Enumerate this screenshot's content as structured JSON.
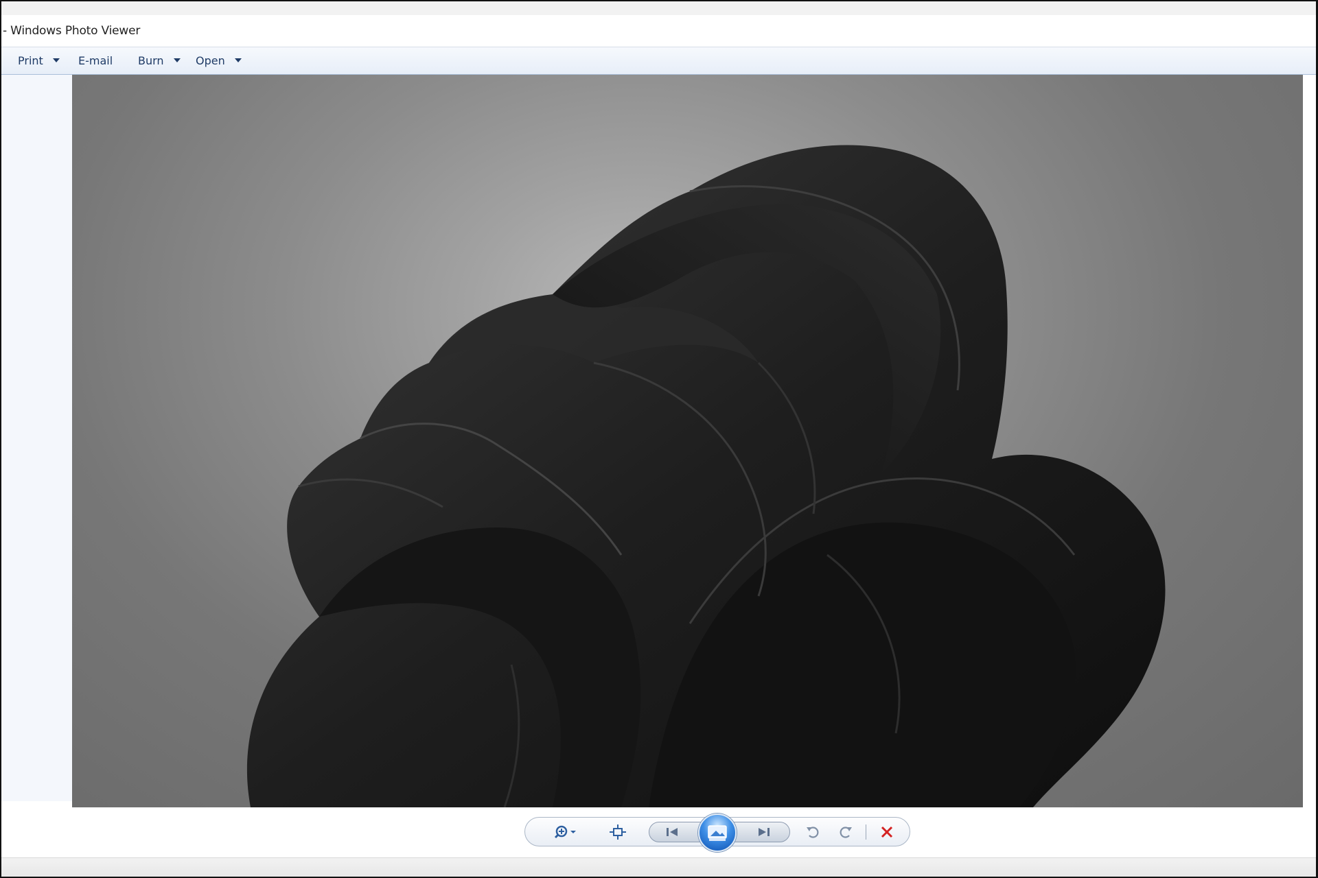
{
  "window": {
    "title": "- Windows Photo Viewer"
  },
  "menu": [
    {
      "label": "Print",
      "has_dropdown": true
    },
    {
      "label": "E-mail",
      "has_dropdown": false
    },
    {
      "label": "Burn",
      "has_dropdown": true
    },
    {
      "label": "Open",
      "has_dropdown": true
    }
  ],
  "photo": {
    "description_icon": "abstract-black-ribbon-bloom-image"
  },
  "controls": {
    "icons": [
      "zoom-icon",
      "actual-size-icon",
      "previous-icon",
      "slideshow-icon",
      "next-icon",
      "rotate-counterclockwise-icon",
      "rotate-clockwise-icon",
      "delete-icon"
    ]
  },
  "colors": {
    "menu_text": "#1f3b66",
    "delete": "#d42121",
    "accent": "#2f7fdc"
  }
}
